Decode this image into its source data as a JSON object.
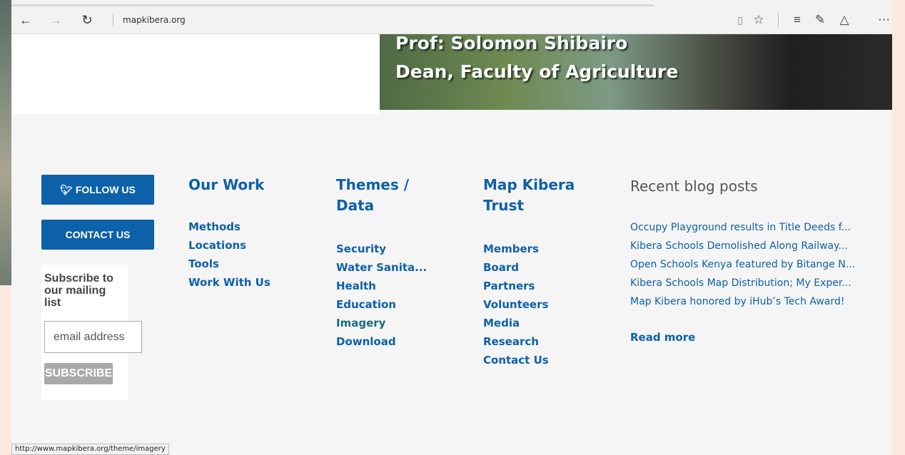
{
  "browser": {
    "url": "mapkibera.org",
    "status_url": "http://www.mapkibera.org/theme/imagery",
    "icons": {
      "back": "arrow-left-icon",
      "forward": "arrow-right-icon",
      "refresh": "refresh-icon",
      "reading_view": "book-icon",
      "favorite": "star-icon",
      "hub": "hub-icon",
      "notes": "pen-icon",
      "share": "share-icon",
      "more": "more-icon"
    }
  },
  "hero": {
    "line1": "Prof: Solomon Shibairo",
    "line2": "Dean, Faculty of Agriculture"
  },
  "social": {
    "follow_label": "FOLLOW US",
    "contact_label": "CONTACT US"
  },
  "subscribe": {
    "title": "Subscribe to our mailing list",
    "placeholder": "email address",
    "button_label": "SUBSCRIBE"
  },
  "columns": [
    {
      "title": "Our Work",
      "links": [
        "Methods",
        "Locations",
        "Tools",
        "Work With Us"
      ]
    },
    {
      "title": "Themes / Data",
      "links": [
        "Security",
        "Water Sanita...",
        "Health",
        "Education",
        "Imagery",
        "Download"
      ]
    },
    {
      "title": "Map Kibera Trust",
      "links": [
        "Members",
        "Board",
        "Partners",
        "Volunteers",
        "Media",
        "Research",
        "Contact Us"
      ]
    }
  ],
  "blog": {
    "title": "Recent blog posts",
    "posts": [
      "Occupy Playground results in Title Deeds f...",
      "Kibera Schools Demolished Along Railway...",
      "Open Schools Kenya featured by Bitange N...",
      "Kibera Schools Map Distribution; My Exper...",
      "Map Kibera honored by iHub’s Tech Award!"
    ],
    "read_more": "Read more"
  },
  "colors": {
    "link": "#0d61a8",
    "button": "#0d61a8",
    "subscribe_button": "#a9a9a9"
  }
}
